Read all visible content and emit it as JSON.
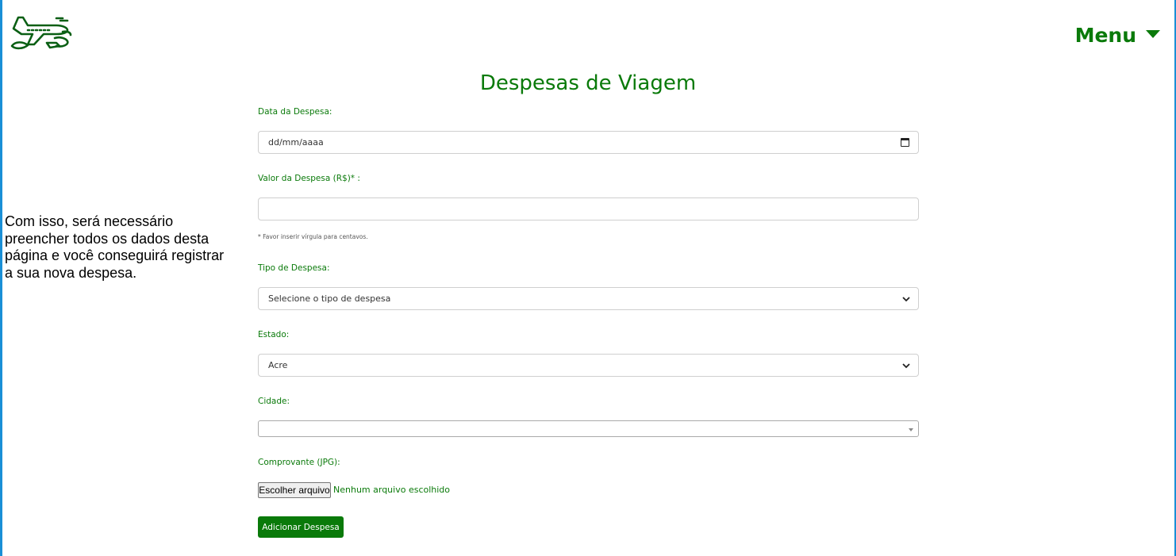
{
  "header": {
    "logo_icon": "airplane-icon",
    "menu_label": "Menu",
    "menu_icon": "caret-down-icon"
  },
  "page": {
    "title": "Despesas de Viagem"
  },
  "side_note": {
    "text": "Com isso, será necessário preencher todos os dados desta página e você conseguirá registrar a sua nova despesa."
  },
  "form": {
    "date": {
      "label": "Data da Despesa:",
      "placeholder": "dd/mm/aaaa",
      "icon": "calendar-icon"
    },
    "amount": {
      "label": "Valor da Despesa (R$)* :",
      "value": "",
      "hint": "* Favor inserir vírgula para centavos."
    },
    "type": {
      "label": "Tipo de Despesa:",
      "selected": "Selecione o tipo de despesa",
      "icon": "chevron-down-icon"
    },
    "state": {
      "label": "Estado:",
      "selected": "Acre",
      "icon": "chevron-down-icon"
    },
    "city": {
      "label": "Cidade:",
      "selected": ""
    },
    "receipt": {
      "label": "Comprovante (JPG):",
      "button_label": "Escolher arquivo",
      "status": "Nenhum arquivo escolhido"
    },
    "submit_label": "Adicionar Despesa"
  },
  "colors": {
    "primary_green": "#0a7a0a",
    "frame_blue": "#1a8fd6"
  }
}
